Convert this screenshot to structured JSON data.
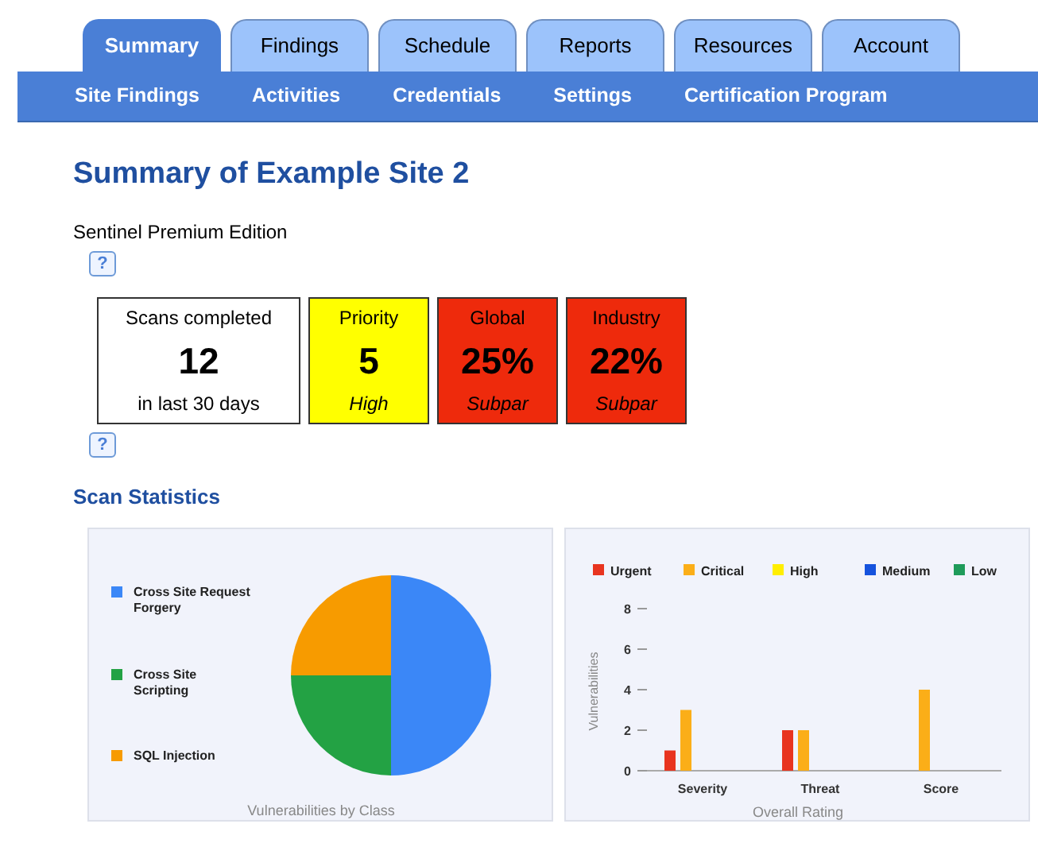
{
  "tabs": [
    {
      "label": "Summary",
      "selected": true
    },
    {
      "label": "Findings",
      "selected": false
    },
    {
      "label": "Schedule",
      "selected": false
    },
    {
      "label": "Reports",
      "selected": false
    },
    {
      "label": "Resources",
      "selected": false
    },
    {
      "label": "Account",
      "selected": false
    }
  ],
  "subnav": [
    "Site Findings",
    "Activities",
    "Credentials",
    "Settings",
    "Certification Program"
  ],
  "heading": "Summary of Example Site 2",
  "edition": "Sentinel Premium Edition",
  "help_icon": "?",
  "cards": [
    {
      "title": "Scans completed",
      "value": "12",
      "note": "in last 30 days",
      "color": "#ffffff",
      "italic": false
    },
    {
      "title": "Priority",
      "value": "5",
      "note": "High",
      "color": "#ffff00",
      "italic": true
    },
    {
      "title": "Global",
      "value": "25%",
      "note": "Subpar",
      "color": "#ee2a0c",
      "italic": true
    },
    {
      "title": "Industry",
      "value": "22%",
      "note": "Subpar",
      "color": "#ee2a0c",
      "italic": true
    }
  ],
  "section_title": "Scan Statistics",
  "pie": {
    "chart_data": {
      "type": "pie",
      "xlabel": "Vulnerabilities by Class",
      "categories": [
        "Cross Site Request Forgery",
        "Cross Site Scripting",
        "SQL Injection"
      ],
      "values": [
        50,
        25,
        25
      ],
      "legend": true,
      "colors": [
        "#3b87f7",
        "#23a244",
        "#f79b00"
      ]
    }
  },
  "bars": {
    "chart_data": {
      "type": "bar",
      "xlabel": "Overall Rating",
      "ylabel": "Vulnerabilities",
      "categories": [
        "Severity",
        "Threat",
        "Score"
      ],
      "legend": true,
      "ylim": [
        0,
        8
      ],
      "yticks": [
        0,
        2,
        4,
        6,
        8
      ],
      "series": [
        {
          "name": "Urgent",
          "color": "#e8341f",
          "values": [
            1,
            2,
            0
          ]
        },
        {
          "name": "Critical",
          "color": "#fbae18",
          "values": [
            3,
            2,
            4
          ]
        },
        {
          "name": "High",
          "color": "#ffee00",
          "values": [
            0,
            0,
            0
          ]
        },
        {
          "name": "Medium",
          "color": "#1552dd",
          "values": [
            0,
            0,
            0
          ]
        },
        {
          "name": "Low",
          "color": "#1f9b5a",
          "values": [
            0,
            0,
            0
          ]
        }
      ]
    }
  }
}
